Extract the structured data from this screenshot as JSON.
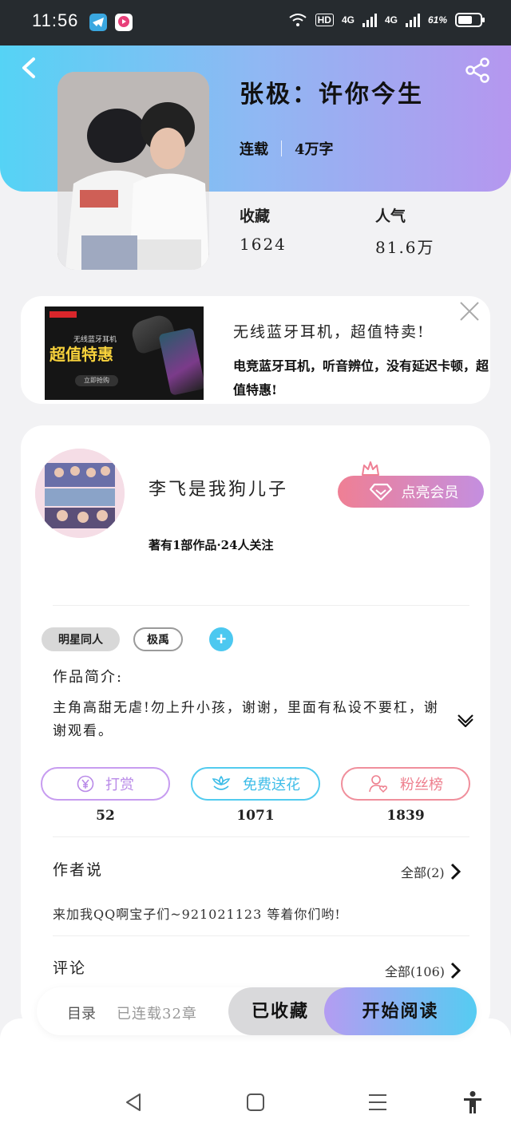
{
  "status_bar": {
    "time": "11:56",
    "hd": "HD",
    "net1": "4G",
    "net2": "4G",
    "battery": "61%"
  },
  "book": {
    "title": "张极：许你今生",
    "status": "连载",
    "words": "4万字",
    "favorites_label": "收藏",
    "favorites_value": "1624",
    "popularity_label": "人气",
    "popularity_value": "81.6万"
  },
  "ad": {
    "image_small": "无线蓝牙耳机",
    "image_big": "超值特惠",
    "image_button": "立即抢购",
    "title": "无线蓝牙耳机，超值特卖!",
    "description": "电竞蓝牙耳机，听音辨位，没有延迟卡顿，超值特惠!"
  },
  "author": {
    "name": "李飞是我狗儿子",
    "stats": "著有1部作品·24人关注",
    "vip_label": "点亮会员"
  },
  "tags": [
    "明星同人",
    "极禹"
  ],
  "intro": {
    "heading": "作品简介:",
    "body": "主角高甜无虐!勿上升小孩，谢谢，里面有私设不要杠，谢谢观看。"
  },
  "actions": [
    {
      "label": "打赏",
      "count": "52",
      "color": "#b98ae8"
    },
    {
      "label": "免费送花",
      "count": "1071",
      "color": "#3fbde8"
    },
    {
      "label": "粉丝榜",
      "count": "1839",
      "color": "#ee7f8e"
    }
  ],
  "author_says": {
    "heading": "作者说",
    "all_label": "全部(2)",
    "text": "来加我QQ啊宝子们~921021123 等着你们哟!"
  },
  "comments": {
    "heading": "评论",
    "all_label": "全部(106)"
  },
  "bottom_bar": {
    "toc": "目录",
    "serial": "已连载32章",
    "favorited": "已收藏",
    "start_reading": "开始阅读"
  },
  "colors": {
    "header_start": "#55d3f5",
    "header_end": "#b597ef",
    "accent_blue": "#4cc8f0"
  }
}
